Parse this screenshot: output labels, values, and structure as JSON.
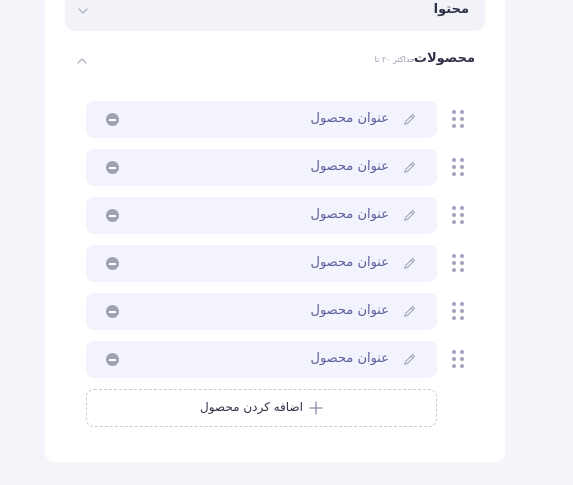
{
  "sections": {
    "content": {
      "title": "محتوا"
    },
    "products": {
      "title": "محصولات",
      "hint": "حداکثر ۲۰ تا",
      "items": [
        {
          "label": "عنوان محصول"
        },
        {
          "label": "عنوان محصول"
        },
        {
          "label": "عنوان محصول"
        },
        {
          "label": "عنوان محصول"
        },
        {
          "label": "عنوان محصول"
        },
        {
          "label": "عنوان محصول"
        }
      ],
      "add_label": "اضافه کردن محصول"
    }
  },
  "colors": {
    "panel_bg": "#ffffff",
    "item_bg": "#f2f3fc",
    "item_text": "#5b5f9c",
    "heading_text": "#2f3045"
  },
  "icons": [
    "chevron-down-icon",
    "chevron-up-icon",
    "drag-handle-icon",
    "pencil-icon",
    "minus-circle-icon",
    "plus-icon"
  ]
}
